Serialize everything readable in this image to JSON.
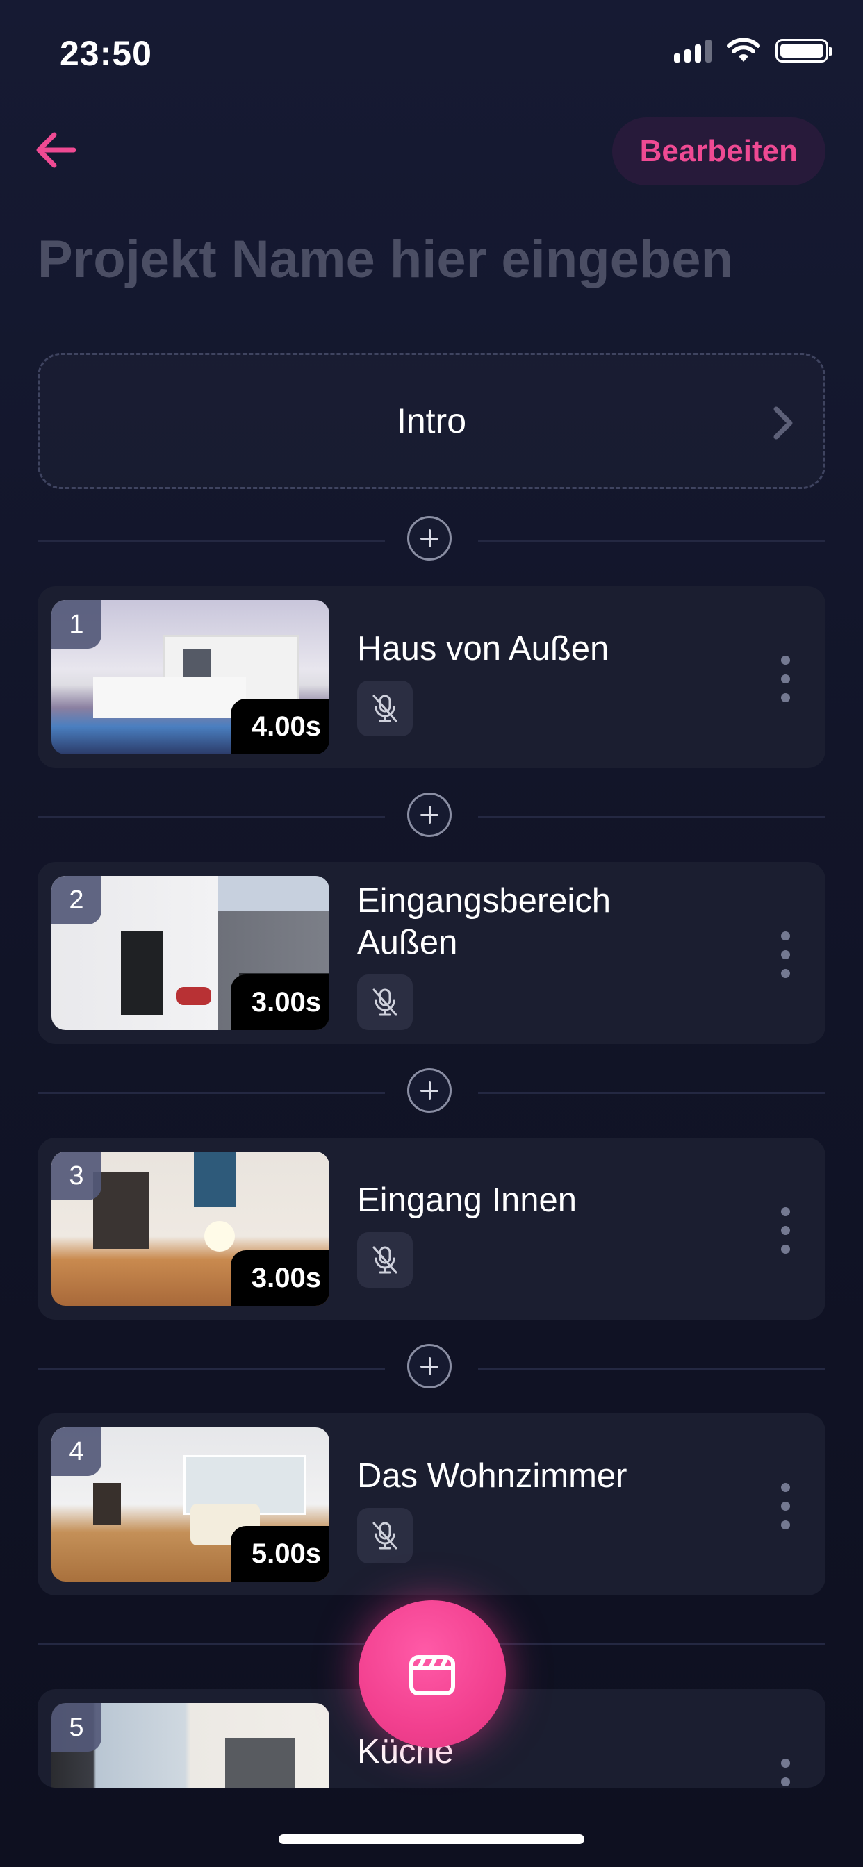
{
  "status_bar": {
    "time": "23:50"
  },
  "header": {
    "edit_label": "Bearbeiten",
    "title_placeholder": "Projekt Name hier eingeben"
  },
  "intro": {
    "label": "Intro"
  },
  "scenes": [
    {
      "number": "1",
      "title": "Haus von Außen",
      "duration": "4.00s",
      "audio": "muted"
    },
    {
      "number": "2",
      "title": "Eingangsbereich Außen",
      "duration": "3.00s",
      "audio": "muted"
    },
    {
      "number": "3",
      "title": "Eingang Innen",
      "duration": "3.00s",
      "audio": "muted"
    },
    {
      "number": "4",
      "title": "Das Wohnzimmer",
      "duration": "5.00s",
      "audio": "muted"
    },
    {
      "number": "5",
      "title": "Küche",
      "duration": "",
      "audio": "muted"
    }
  ],
  "colors": {
    "accent": "#ef4a93",
    "background": "#121529",
    "card": "#1b1e30"
  },
  "icons": [
    "back-arrow-icon",
    "chevron-right-icon",
    "plus-icon",
    "mic-off-icon",
    "more-vertical-icon",
    "clapperboard-icon",
    "wifi-icon",
    "battery-icon",
    "signal-icon"
  ]
}
